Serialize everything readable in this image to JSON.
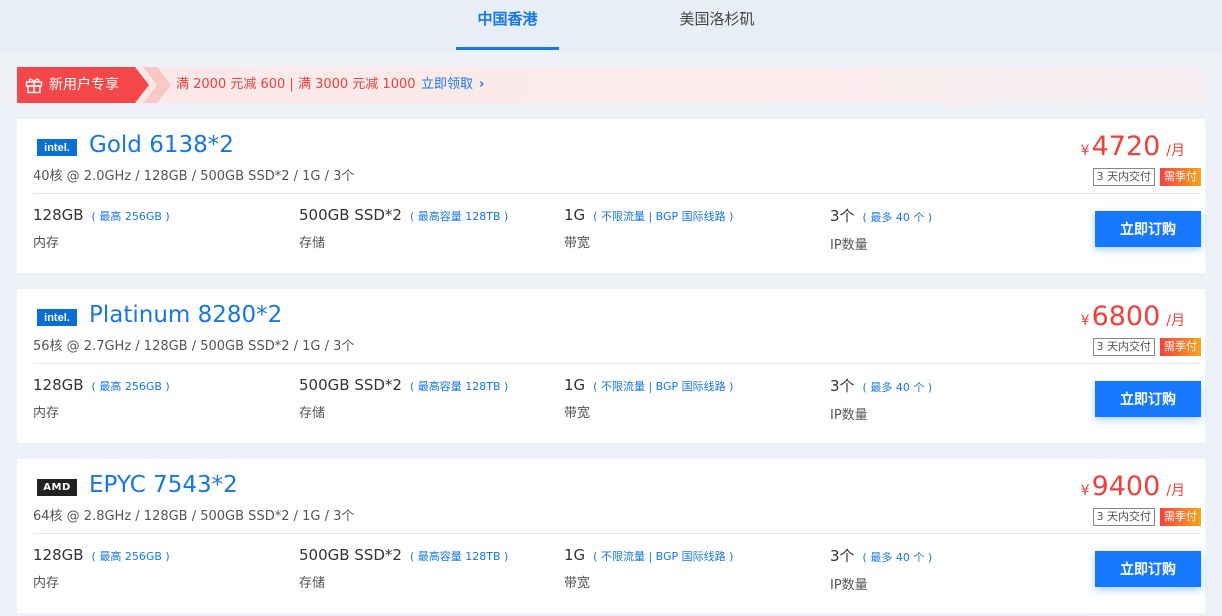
{
  "tabs": [
    {
      "label": "中国香港",
      "active": true
    },
    {
      "label": "美国洛杉矶",
      "active": false
    }
  ],
  "promo": {
    "tag": "新用户专享",
    "text": "满 2000 元减 600 | 满 3000 元减 1000",
    "link": "立即领取"
  },
  "colors": {
    "accent": "#1677e5",
    "price": "#f0403c",
    "promo_tag": "#f4474a"
  },
  "products": [
    {
      "brand": "intel",
      "logo_text": "intel.",
      "title": "Gold 6138*2",
      "subtitle": "40核 @ 2.0GHz / 128GB / 500GB SSD*2 / 1G / 3个",
      "currency": "¥",
      "price": "4720",
      "unit": "/月",
      "term_badge": "3 天内交付",
      "pay_badge": "需季付",
      "specs": [
        {
          "value": "128GB",
          "note": "( 最高 256GB )",
          "label": "内存"
        },
        {
          "value": "500GB SSD*2",
          "note": "( 最高容量 128TB )",
          "label": "存储"
        },
        {
          "value": "1G",
          "note": "( 不限流量 | BGP 国际线路 )",
          "label": "带宽"
        },
        {
          "value": "3个",
          "note": "( 最多 40 个 )",
          "label": "IP数量"
        }
      ],
      "buy_label": "立即订购"
    },
    {
      "brand": "intel",
      "logo_text": "intel.",
      "title": "Platinum 8280*2",
      "subtitle": "56核 @ 2.7GHz / 128GB / 500GB SSD*2 / 1G / 3个",
      "currency": "¥",
      "price": "6800",
      "unit": "/月",
      "term_badge": "3 天内交付",
      "pay_badge": "需季付",
      "specs": [
        {
          "value": "128GB",
          "note": "( 最高 256GB )",
          "label": "内存"
        },
        {
          "value": "500GB SSD*2",
          "note": "( 最高容量 128TB )",
          "label": "存储"
        },
        {
          "value": "1G",
          "note": "( 不限流量 | BGP 国际线路 )",
          "label": "带宽"
        },
        {
          "value": "3个",
          "note": "( 最多 40 个 )",
          "label": "IP数量"
        }
      ],
      "buy_label": "立即订购"
    },
    {
      "brand": "amd",
      "logo_text": "AMD",
      "title": "EPYC 7543*2",
      "subtitle": "64核 @ 2.8GHz / 128GB / 500GB SSD*2 / 1G / 3个",
      "currency": "¥",
      "price": "9400",
      "unit": "/月",
      "term_badge": "3 天内交付",
      "pay_badge": "需季付",
      "specs": [
        {
          "value": "128GB",
          "note": "( 最高 256GB )",
          "label": "内存"
        },
        {
          "value": "500GB SSD*2",
          "note": "( 最高容量 128TB )",
          "label": "存储"
        },
        {
          "value": "1G",
          "note": "( 不限流量 | BGP 国际线路 )",
          "label": "带宽"
        },
        {
          "value": "3个",
          "note": "( 最多 40 个 )",
          "label": "IP数量"
        }
      ],
      "buy_label": "立即订购"
    }
  ]
}
